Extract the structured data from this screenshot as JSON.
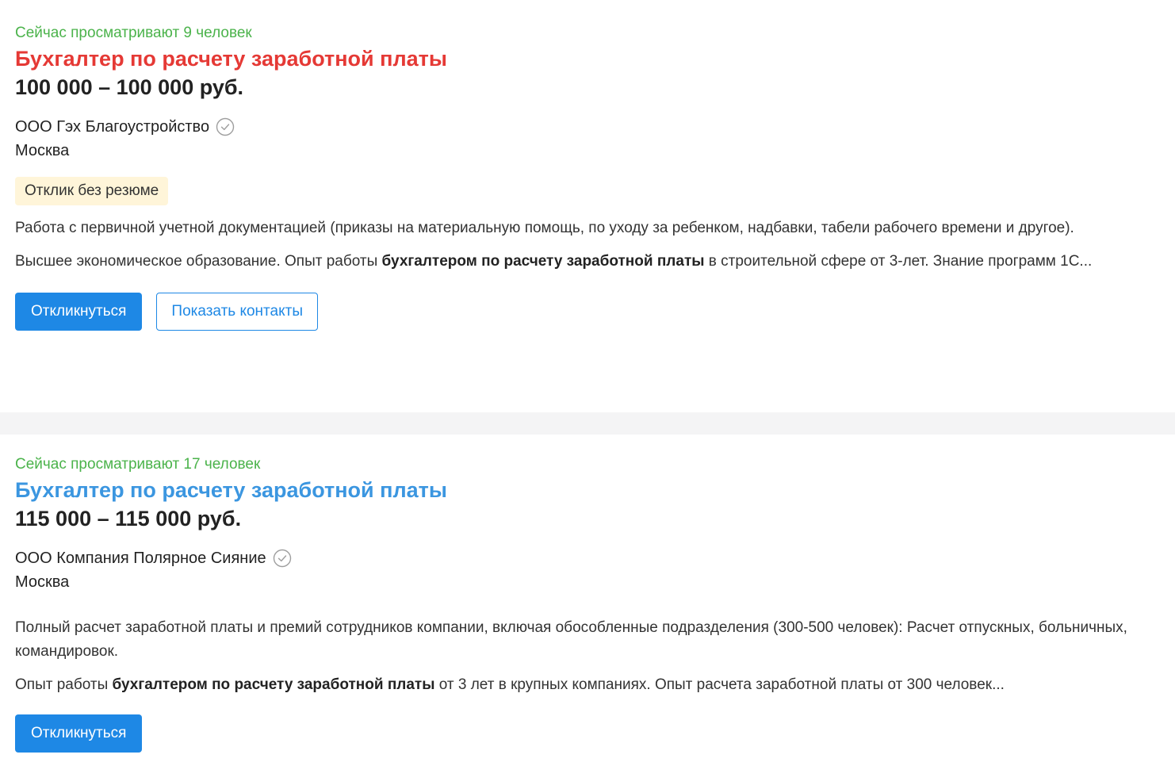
{
  "vacancies": [
    {
      "viewers": "Сейчас просматривают 9 человек",
      "title": "Бухгалтер по расчету заработной платы",
      "salary": "100 000 – 100 000 руб.",
      "company": "ООО Гэх Благоустройство",
      "city": "Москва",
      "badge": "Отклик без резюме",
      "responsibility": "Работа с первичной учетной документацией (приказы на материальную помощь, по уходу за ребенком, надбавки, табели рабочего времени и другое).",
      "requirement": {
        "before": "Высшее экономическое образование. Опыт работы ",
        "bold": "бухгалтером по расчету заработной платы",
        "after": " в строительной сфере от 3-лет. Знание программ 1С..."
      },
      "respond_label": "Откликнуться",
      "contacts_label": "Показать контакты",
      "title_color": "#e53935"
    },
    {
      "viewers": "Сейчас просматривают 17 человек",
      "title": "Бухгалтер по расчету заработной платы",
      "salary": "115 000 – 115 000 руб.",
      "company": "ООО Компания Полярное Сияние",
      "city": "Москва",
      "responsibility": "Полный расчет заработной платы и премий сотрудников компании, включая обособленные подразделения (300-500 человек): Расчет отпускных, больничных, командировок.",
      "requirement": {
        "before": "Опыт работы ",
        "bold": "бухгалтером по расчету заработной платы",
        "after": " от 3 лет в крупных компаниях. Опыт расчета заработной платы от 300 человек..."
      },
      "respond_label": "Откликнуться",
      "title_color": "#3b96e0"
    }
  ],
  "colors": {
    "viewers": "#4bb34b",
    "primary_button": "#1e88e5",
    "badge_bg": "#fff5d9"
  },
  "icons": {
    "verified": "check-circle-icon"
  }
}
